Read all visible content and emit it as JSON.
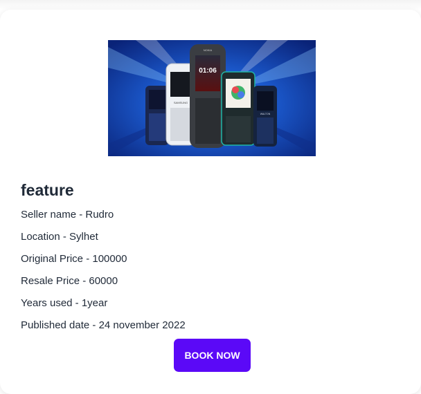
{
  "product": {
    "title": "feature",
    "seller": "Seller name - Rudro",
    "location": "Location - Sylhet",
    "original_price": "Original Price - 100000",
    "resale_price": "Resale Price - 60000",
    "years_used": "Years used - 1year",
    "published": "Published date - 24 november 2022",
    "image_icon": "feature-phones-image",
    "image_texts": {
      "clock": "01:06",
      "brand1": "NOKIA",
      "brand2": "SAMSUNG",
      "brand3": "WALTON"
    }
  },
  "actions": {
    "book_label": "Book Now"
  },
  "colors": {
    "accent": "#5b09f7",
    "text": "#1f2937",
    "image_bg": "#0a3aa8"
  }
}
